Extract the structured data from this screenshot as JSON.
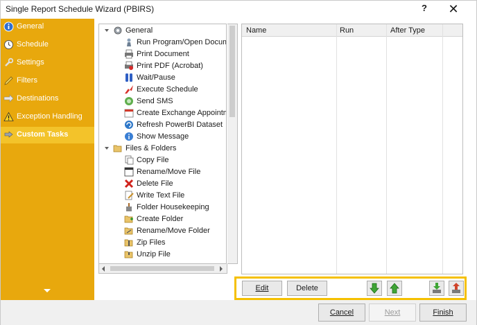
{
  "window": {
    "title": "Single Report Schedule Wizard (PBIRS)",
    "help_glyph": "?",
    "close_glyph": "✕"
  },
  "sidebar": {
    "items": [
      {
        "label": "General",
        "icon": "info-icon",
        "active": false
      },
      {
        "label": "Schedule",
        "icon": "clock-icon",
        "active": false
      },
      {
        "label": "Settings",
        "icon": "wrench-icon",
        "active": false
      },
      {
        "label": "Filters",
        "icon": "pencil-icon",
        "active": false
      },
      {
        "label": "Destinations",
        "icon": "arrow-icon",
        "active": false
      },
      {
        "label": "Exception Handling",
        "icon": "warning-icon",
        "active": false
      },
      {
        "label": "Custom Tasks",
        "icon": "tasks-icon",
        "active": true
      }
    ],
    "scroll_down_icon": "chevron-down-icon"
  },
  "tree": {
    "groups": [
      {
        "label": "General",
        "icon": "gear-icon",
        "items": [
          {
            "label": "Run Program/Open Document",
            "icon": "run-program-icon"
          },
          {
            "label": "Print Document",
            "icon": "printer-icon"
          },
          {
            "label": "Print PDF (Acrobat)",
            "icon": "pdf-print-icon"
          },
          {
            "label": "Wait/Pause",
            "icon": "pause-icon"
          },
          {
            "label": "Execute Schedule",
            "icon": "execute-icon"
          },
          {
            "label": "Send SMS",
            "icon": "sms-icon"
          },
          {
            "label": "Create Exchange Appointment",
            "icon": "calendar-icon"
          },
          {
            "label": "Refresh PowerBI Dataset",
            "icon": "refresh-icon"
          },
          {
            "label": "Show Message",
            "icon": "message-icon"
          }
        ]
      },
      {
        "label": "Files & Folders",
        "icon": "folder-open-icon",
        "items": [
          {
            "label": "Copy File",
            "icon": "copy-file-icon"
          },
          {
            "label": "Rename/Move File",
            "icon": "rename-file-icon"
          },
          {
            "label": "Delete File",
            "icon": "delete-icon"
          },
          {
            "label": "Write Text File",
            "icon": "write-text-icon"
          },
          {
            "label": "Folder Housekeeping",
            "icon": "housekeeping-icon"
          },
          {
            "label": "Create Folder",
            "icon": "create-folder-icon"
          },
          {
            "label": "Rename/Move Folder",
            "icon": "rename-folder-icon"
          },
          {
            "label": "Zip Files",
            "icon": "zip-icon"
          },
          {
            "label": "Unzip File",
            "icon": "unzip-icon"
          }
        ]
      }
    ]
  },
  "task_grid": {
    "columns": [
      "Name",
      "Run",
      "After Type"
    ],
    "rows": []
  },
  "actions": {
    "edit_label": "Edit",
    "delete_label": "Delete",
    "move_down_icon": "arrow-down-icon",
    "move_up_icon": "arrow-up-icon",
    "import_icon": "import-icon",
    "export_icon": "export-icon"
  },
  "footer": {
    "cancel_label": "Cancel",
    "next_label": "Next",
    "finish_label": "Finish"
  },
  "colors": {
    "sidebar": "#e8a80d",
    "sidebar_active": "#f3c32a",
    "highlight_border": "#f5c000"
  }
}
